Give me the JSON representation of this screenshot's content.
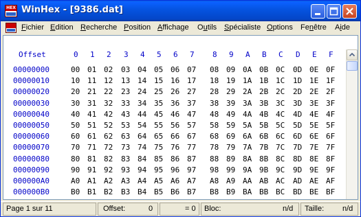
{
  "window": {
    "app_name": "WinHex",
    "title": "WinHex - [9386.dat]",
    "icon_text": "HEX"
  },
  "menu": [
    {
      "label": "Fichier",
      "accel": "F"
    },
    {
      "label": "Edition",
      "accel": "E"
    },
    {
      "label": "Recherche",
      "accel": "R"
    },
    {
      "label": "Position",
      "accel": "P"
    },
    {
      "label": "Affichage",
      "accel": "A"
    },
    {
      "label": "Outils",
      "accel": "u"
    },
    {
      "label": "Spécialiste",
      "accel": "S"
    },
    {
      "label": "Options",
      "accel": "O"
    },
    {
      "label": "Fenêtre",
      "accel": "n"
    },
    {
      "label": "Aide",
      "accel": "i"
    }
  ],
  "mdi_controls": {
    "minimize": "_",
    "restore": "⧉",
    "close": "×"
  },
  "hex_header": {
    "offset_label": "Offset",
    "columns": [
      "0",
      "1",
      "2",
      "3",
      "4",
      "5",
      "6",
      "7",
      "8",
      "9",
      "A",
      "B",
      "C",
      "D",
      "E",
      "F"
    ]
  },
  "hex_rows": [
    {
      "offset": "00000000",
      "bytes": [
        "00",
        "01",
        "02",
        "03",
        "04",
        "05",
        "06",
        "07",
        "08",
        "09",
        "0A",
        "0B",
        "0C",
        "0D",
        "0E",
        "0F"
      ]
    },
    {
      "offset": "00000010",
      "bytes": [
        "10",
        "11",
        "12",
        "13",
        "14",
        "15",
        "16",
        "17",
        "18",
        "19",
        "1A",
        "1B",
        "1C",
        "1D",
        "1E",
        "1F"
      ]
    },
    {
      "offset": "00000020",
      "bytes": [
        "20",
        "21",
        "22",
        "23",
        "24",
        "25",
        "26",
        "27",
        "28",
        "29",
        "2A",
        "2B",
        "2C",
        "2D",
        "2E",
        "2F"
      ]
    },
    {
      "offset": "00000030",
      "bytes": [
        "30",
        "31",
        "32",
        "33",
        "34",
        "35",
        "36",
        "37",
        "38",
        "39",
        "3A",
        "3B",
        "3C",
        "3D",
        "3E",
        "3F"
      ]
    },
    {
      "offset": "00000040",
      "bytes": [
        "40",
        "41",
        "42",
        "43",
        "44",
        "45",
        "46",
        "47",
        "48",
        "49",
        "4A",
        "4B",
        "4C",
        "4D",
        "4E",
        "4F"
      ]
    },
    {
      "offset": "00000050",
      "bytes": [
        "50",
        "51",
        "52",
        "53",
        "54",
        "55",
        "56",
        "57",
        "58",
        "59",
        "5A",
        "5B",
        "5C",
        "5D",
        "5E",
        "5F"
      ]
    },
    {
      "offset": "00000060",
      "bytes": [
        "60",
        "61",
        "62",
        "63",
        "64",
        "65",
        "66",
        "67",
        "68",
        "69",
        "6A",
        "6B",
        "6C",
        "6D",
        "6E",
        "6F"
      ]
    },
    {
      "offset": "00000070",
      "bytes": [
        "70",
        "71",
        "72",
        "73",
        "74",
        "75",
        "76",
        "77",
        "78",
        "79",
        "7A",
        "7B",
        "7C",
        "7D",
        "7E",
        "7F"
      ]
    },
    {
      "offset": "00000080",
      "bytes": [
        "80",
        "81",
        "82",
        "83",
        "84",
        "85",
        "86",
        "87",
        "88",
        "89",
        "8A",
        "8B",
        "8C",
        "8D",
        "8E",
        "8F"
      ]
    },
    {
      "offset": "00000090",
      "bytes": [
        "90",
        "91",
        "92",
        "93",
        "94",
        "95",
        "96",
        "97",
        "98",
        "99",
        "9A",
        "9B",
        "9C",
        "9D",
        "9E",
        "9F"
      ]
    },
    {
      "offset": "000000A0",
      "bytes": [
        "A0",
        "A1",
        "A2",
        "A3",
        "A4",
        "A5",
        "A6",
        "A7",
        "A8",
        "A9",
        "AA",
        "AB",
        "AC",
        "AD",
        "AE",
        "AF"
      ]
    },
    {
      "offset": "000000B0",
      "bytes": [
        "B0",
        "B1",
        "B2",
        "B3",
        "B4",
        "B5",
        "B6",
        "B7",
        "B8",
        "B9",
        "BA",
        "BB",
        "BC",
        "BD",
        "BE",
        "BF"
      ]
    }
  ],
  "status": {
    "page": "Page 1 sur 11",
    "offset_label": "Offset:",
    "offset_value": "0",
    "equals_value": "= 0",
    "block_label": "Bloc:",
    "block_value": "n/d",
    "size_label": "Taille:",
    "size_value": "n/d"
  },
  "colors": {
    "titlebar": "#0553e0",
    "header_text": "#0000c8",
    "icon_red": "#cc0000"
  }
}
